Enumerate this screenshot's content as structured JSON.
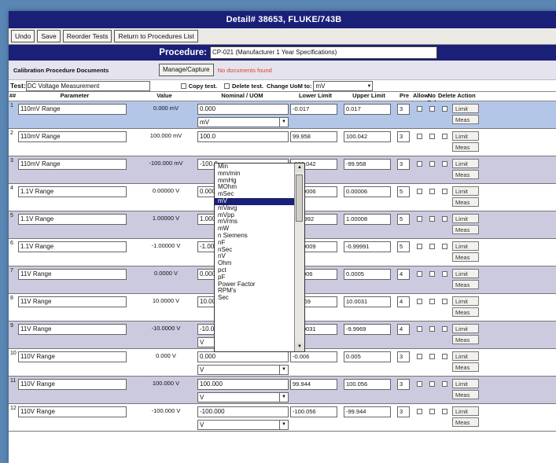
{
  "title": "Detail# 38653, FLUKE/743B",
  "toolbar": {
    "undo": "Undo",
    "save": "Save",
    "reorder": "Reorder Tests",
    "return": "Return to Procedures List"
  },
  "procedure": {
    "label": "Procedure:",
    "value": "CP-021 (Manufacturer 1 Year Specifications)"
  },
  "docs": {
    "label": "Calibration Procedure Documents",
    "manage": "Manage/Capture",
    "none": "No documents found"
  },
  "test": {
    "label": "Test:",
    "value": "DC Voltage Measurement",
    "copy": "Copy test.",
    "delete": "Delete test.",
    "change": "Change UoM to:",
    "uom": "mV"
  },
  "headers": {
    "num": "##",
    "param": "Parameter",
    "value": "Value",
    "nominal": "Nominal / UOM",
    "lower": "Lower Limit",
    "upper": "Upper Limit",
    "pre": "Pre",
    "allow": "Allow",
    "notol": "No Tol",
    "delete": "Delete",
    "action": "Action"
  },
  "rows": [
    {
      "n": "1",
      "param": "110mV Range",
      "value": "0.000 mV",
      "nominal": "0.000",
      "uom": "mV",
      "lower": "-0.017",
      "upper": "0.017",
      "pre": "3"
    },
    {
      "n": "2",
      "param": "110mV Range",
      "value": "100.000 mV",
      "nominal": "100.0",
      "uom": "",
      "lower": "99.958",
      "upper": "100.042",
      "pre": "3"
    },
    {
      "n": "3",
      "param": "110mV Range",
      "value": "-100.000 mV",
      "nominal": "-100.0",
      "uom": "",
      "lower": "-100.042",
      "upper": "-99.958",
      "pre": "3"
    },
    {
      "n": "4",
      "param": "1.1V Range",
      "value": "0.00000 V",
      "nominal": "0.000",
      "uom": "",
      "lower": "-0.00006",
      "upper": "0.00006",
      "pre": "5"
    },
    {
      "n": "5",
      "param": "1.1V Range",
      "value": "1.00000 V",
      "nominal": "1.000",
      "uom": "",
      "lower": "0.99992",
      "upper": "1.00008",
      "pre": "5"
    },
    {
      "n": "6",
      "param": "1.1V Range",
      "value": "-1.00000 V",
      "nominal": "-1.000",
      "uom": "",
      "lower": "-1.00009",
      "upper": "-0.99991",
      "pre": "5"
    },
    {
      "n": "7",
      "param": "11V Range",
      "value": "0.0000 V",
      "nominal": "0.000",
      "uom": "",
      "lower": "-0.0006",
      "upper": "0.0005",
      "pre": "4"
    },
    {
      "n": "8",
      "param": "11V Range",
      "value": "10.0000 V",
      "nominal": "10.00",
      "uom": "",
      "lower": "9.9969",
      "upper": "10.0031",
      "pre": "4"
    },
    {
      "n": "9",
      "param": "11V Range",
      "value": "-10.0000 V",
      "nominal": "-10.0000",
      "uom": "V",
      "lower": "-10.0031",
      "upper": "-9.9969",
      "pre": "4"
    },
    {
      "n": "10",
      "param": "110V Range",
      "value": "0.000 V",
      "nominal": "0.000",
      "uom": "V",
      "lower": "-0.006",
      "upper": "0.005",
      "pre": "3"
    },
    {
      "n": "11",
      "param": "110V Range",
      "value": "100.000 V",
      "nominal": "100.000",
      "uom": "V",
      "lower": "99.944",
      "upper": "100.056",
      "pre": "3"
    },
    {
      "n": "12",
      "param": "110V Range",
      "value": "-100.000 V",
      "nominal": "-100.000",
      "uom": "V",
      "lower": "-100.056",
      "upper": "-99.944",
      "pre": "3"
    }
  ],
  "actions": {
    "limit": "Limit",
    "meas": "Meas"
  },
  "dropdown": {
    "items": [
      "Min",
      "mm/min",
      "mmHg",
      "MOhm",
      "mSec",
      "mV",
      "mVavg",
      "mVpp",
      "mVrms",
      "mW",
      "n Siemens",
      "nF",
      "nSec",
      "nV",
      "Ohm",
      "pct",
      "pF",
      "Power Factor",
      "RPM's",
      "Sec"
    ],
    "selected": "mV"
  }
}
